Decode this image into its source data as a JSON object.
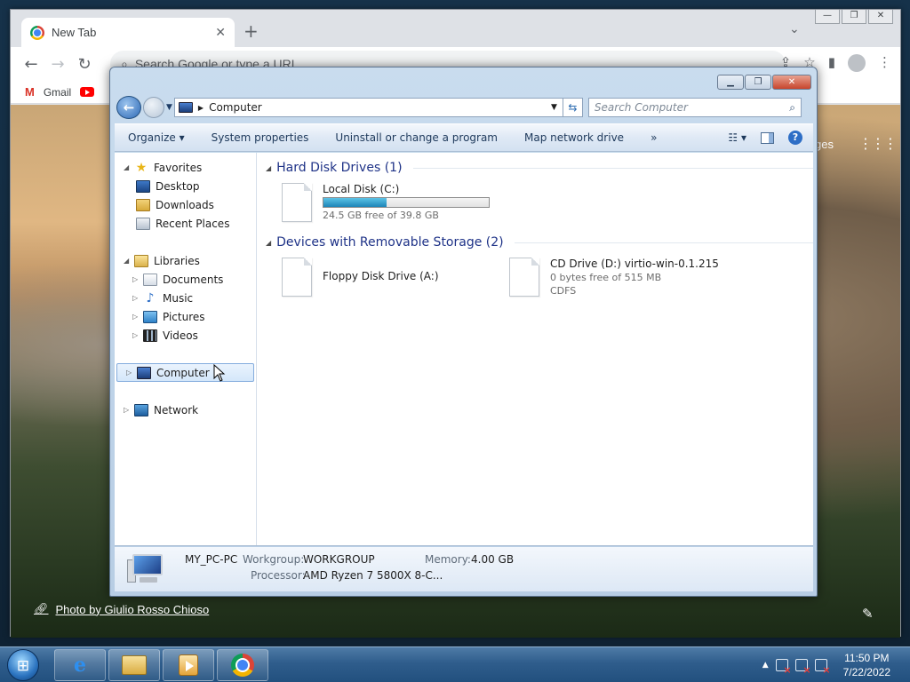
{
  "chrome": {
    "tab_title": "New Tab",
    "omnibox_placeholder": "Search Google or type a URL",
    "bookmarks": [
      "Gmail"
    ],
    "ntp_right_text": "ges",
    "photo_credit": "Photo by Giulio Rosso Chioso"
  },
  "explorer": {
    "breadcrumb": "Computer",
    "search_placeholder": "Search Computer",
    "commands": [
      "Organize",
      "System properties",
      "Uninstall or change a program",
      "Map network drive"
    ],
    "nav": {
      "favorites": "Favorites",
      "desktop": "Desktop",
      "downloads": "Downloads",
      "recent_places": "Recent Places",
      "libraries": "Libraries",
      "documents": "Documents",
      "music": "Music",
      "pictures": "Pictures",
      "videos": "Videos",
      "computer": "Computer",
      "network": "Network"
    },
    "groups": {
      "hdd_header": "Hard Disk Drives (1)",
      "removable_header": "Devices with Removable Storage (2)"
    },
    "drives": {
      "c_name": "Local Disk (C:)",
      "c_free": "24.5 GB free of 39.8 GB",
      "c_used_fraction": 0.38,
      "a_name": "Floppy Disk Drive (A:)",
      "d_name": "CD Drive (D:) virtio-win-0.1.215",
      "d_free": "0 bytes free of 515 MB",
      "d_fs": "CDFS"
    },
    "details": {
      "pc_name": "MY_PC-PC",
      "workgroup_label": "Workgroup:",
      "workgroup": "WORKGROUP",
      "memory_label": "Memory:",
      "memory": "4.00 GB",
      "processor_label": "Processor:",
      "processor": "AMD Ryzen 7 5800X 8-C..."
    }
  },
  "taskbar": {
    "time": "11:50 PM",
    "date": "7/22/2022"
  },
  "colors": {
    "capacity_bar": "#1d85b8",
    "group_header": "#1e3287",
    "taskbar": "#2f5d8c"
  }
}
